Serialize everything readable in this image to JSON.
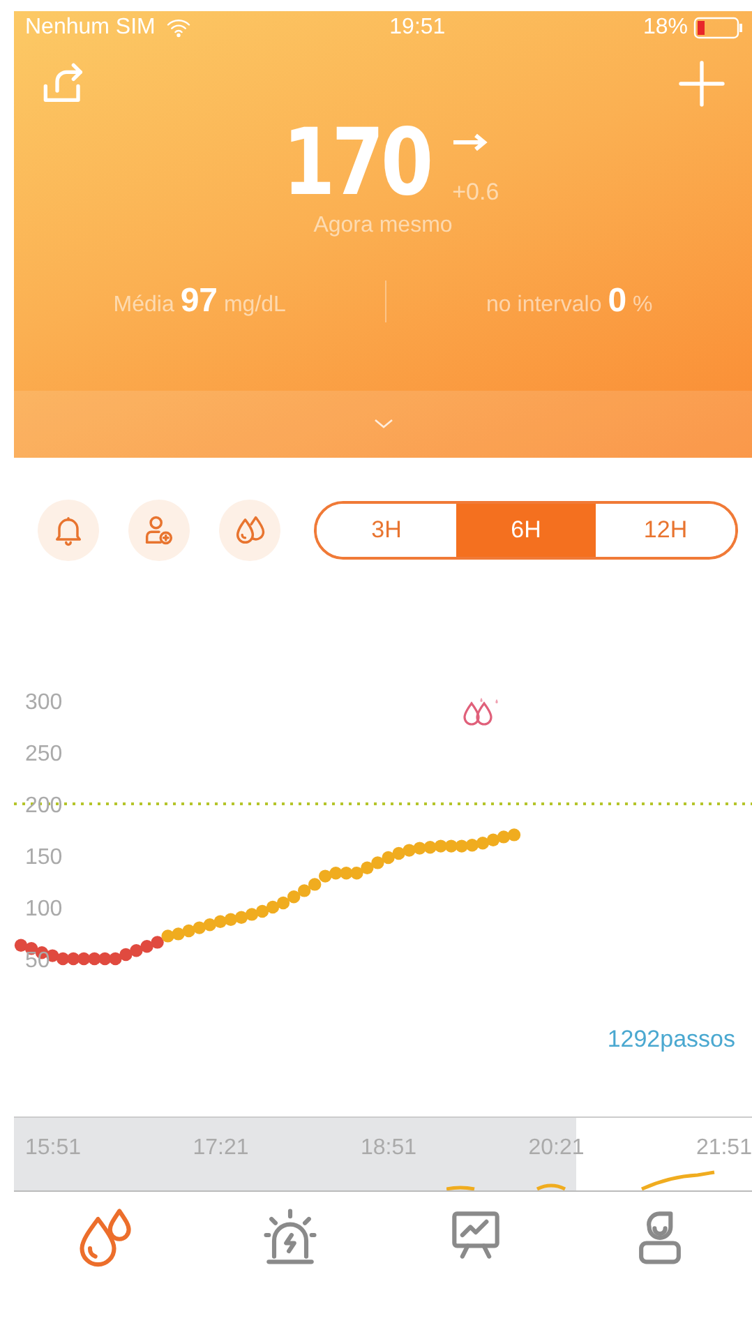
{
  "status_bar": {
    "carrier": "Nenhum SIM",
    "time": "19:51",
    "battery": "18%"
  },
  "reading": {
    "value": "170",
    "trend": "+0.6",
    "time_label": "Agora mesmo"
  },
  "stats": [
    {
      "text": "Média **97** mg/dL"
    },
    {
      "text": "no intervalo **0** %"
    }
  ],
  "tool_buttons": [
    {
      "kind": "bell"
    },
    {
      "kind": "person-add"
    },
    {
      "kind": "drops"
    }
  ],
  "range_tabs": [
    {
      "label": "3H",
      "selected": false
    },
    {
      "label": "6H",
      "selected": true
    },
    {
      "label": "12H",
      "selected": false
    }
  ],
  "chart": {
    "chart_data": {
      "type": "scatter",
      "ylim": [
        50,
        300
      ],
      "yticks": [
        50,
        100,
        150,
        200,
        250,
        300
      ],
      "ref_lines": [
        {
          "axis": "y",
          "value": 200
        }
      ],
      "series": [
        {
          "color": "#e04a3f",
          "values": [
            63,
            60,
            56,
            53,
            50,
            50,
            50,
            50,
            50,
            50,
            54,
            58,
            62,
            66,
            null,
            null,
            null,
            null,
            null,
            null,
            null,
            null,
            null,
            null,
            null,
            null,
            null,
            null,
            null,
            null,
            null,
            null,
            null,
            null,
            null,
            null,
            null,
            null,
            null,
            null,
            null,
            null,
            null,
            null,
            null,
            null,
            null,
            null,
            null,
            null,
            null,
            null,
            null,
            null,
            null,
            null,
            null,
            null,
            null,
            null,
            null,
            null,
            null,
            null,
            null,
            null,
            null,
            null,
            null,
            null
          ]
        },
        {
          "color": "#f0ac1f",
          "values": [
            null,
            null,
            null,
            null,
            null,
            null,
            null,
            null,
            null,
            null,
            null,
            null,
            null,
            null,
            72,
            74,
            77,
            80,
            83,
            86,
            88,
            90,
            93,
            96,
            100,
            104,
            110,
            116,
            122,
            130,
            133,
            133,
            133,
            138,
            143,
            148,
            152,
            155,
            157,
            158,
            159,
            159,
            159,
            160,
            162,
            165,
            168,
            170,
            null,
            null,
            null,
            null,
            null,
            null,
            null,
            null,
            null,
            null,
            null,
            null,
            null,
            null,
            null,
            null,
            null,
            null,
            null,
            null,
            null,
            null
          ]
        }
      ]
    },
    "steps": "1292passos"
  },
  "overview": {
    "times": [
      "15:51",
      "17:21",
      "18:51",
      "20:21",
      "21:51"
    ]
  },
  "tab_bar": [
    {
      "kind": "glucose",
      "selected": true
    },
    {
      "kind": "alarm",
      "selected": false
    },
    {
      "kind": "report",
      "selected": false
    },
    {
      "kind": "profile",
      "selected": false
    }
  ]
}
